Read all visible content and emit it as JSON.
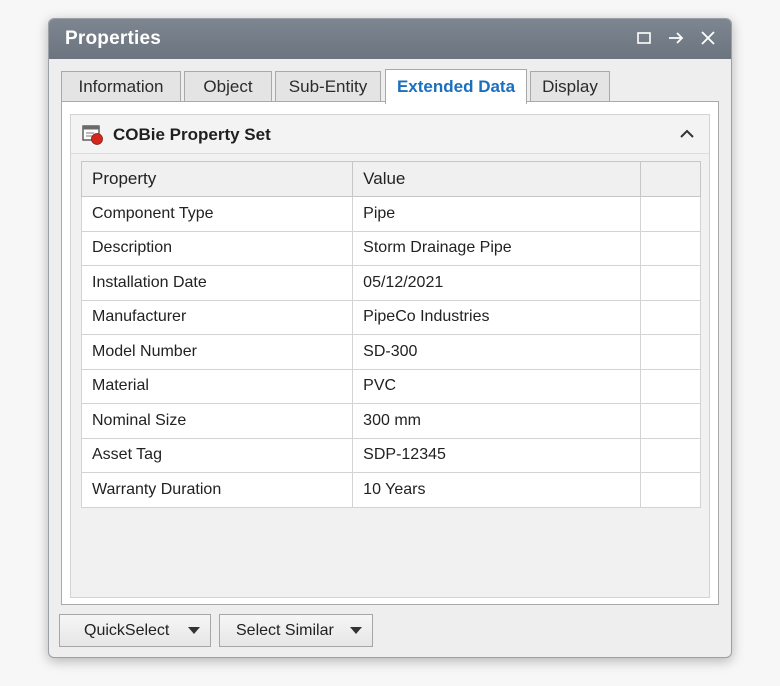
{
  "window": {
    "title": "Properties",
    "controls": [
      "restore-icon",
      "pin-arrow-icon",
      "close-icon"
    ]
  },
  "tabs": [
    {
      "label": "Information",
      "active": false
    },
    {
      "label": "Object",
      "active": false
    },
    {
      "label": "Sub-Entity",
      "active": false
    },
    {
      "label": "Extended Data",
      "active": true
    },
    {
      "label": "Display",
      "active": false
    }
  ],
  "section": {
    "title": "COBie Property Set",
    "icon": "property-set-icon",
    "collapse_icon": "chevron-up-icon"
  },
  "table": {
    "headers": [
      "Property",
      "Value",
      ""
    ],
    "rows": [
      {
        "property": "Component Type",
        "value": "Pipe"
      },
      {
        "property": "Description",
        "value": "Storm Drainage Pipe"
      },
      {
        "property": "Installation Date",
        "value": "05/12/2021"
      },
      {
        "property": "Manufacturer",
        "value": "PipeCo Industries"
      },
      {
        "property": "Model Number",
        "value": "SD-300"
      },
      {
        "property": "Material",
        "value": "PVC"
      },
      {
        "property": "Nominal Size",
        "value": "300 mm"
      },
      {
        "property": "Asset Tag",
        "value": "SDP-12345"
      },
      {
        "property": "Warranty Duration",
        "value": "10 Years"
      }
    ]
  },
  "footer": {
    "quickselect_label": "QuickSelect",
    "select_similar_label": "Select Similar"
  },
  "colors": {
    "titlebar": "#737c86",
    "active_tab_text": "#1b6fc0",
    "icon_red": "#d4261c"
  }
}
